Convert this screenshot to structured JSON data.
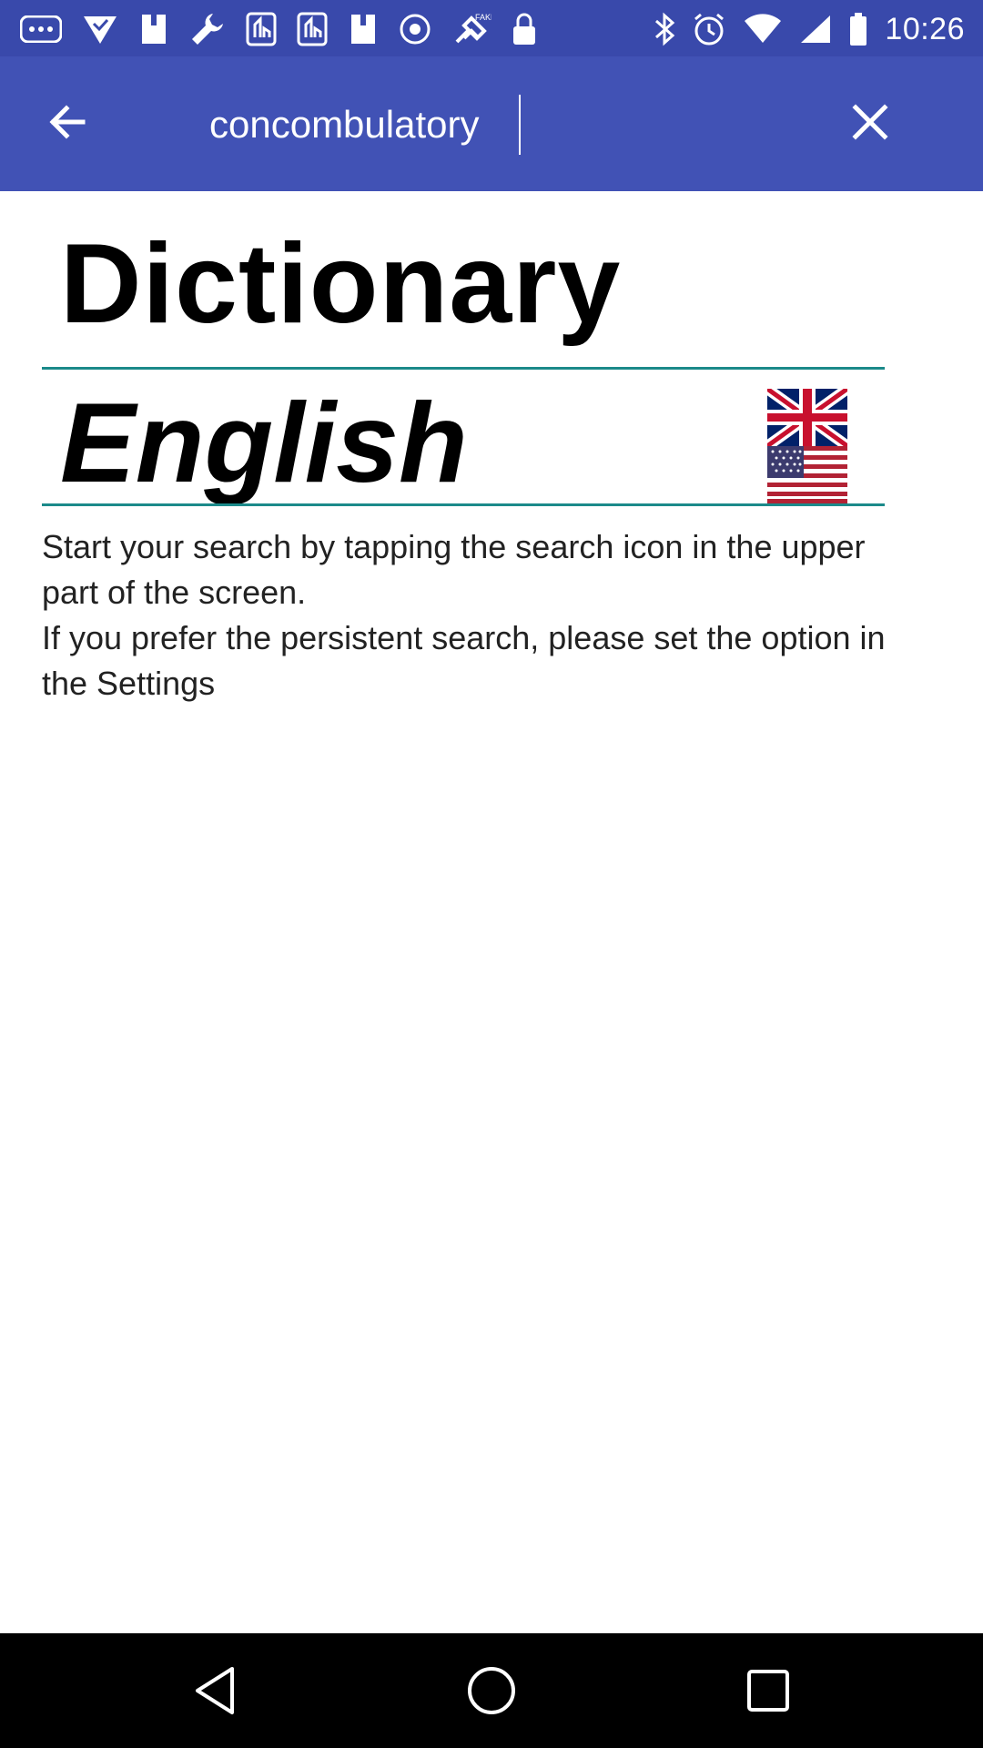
{
  "status_bar": {
    "time": "10:26",
    "left_icons": [
      "more-notifications-icon",
      "vpn-check-icon",
      "toolbox-icon",
      "wrench-icon",
      "signal-tool-icon",
      "signal-tool-icon",
      "toolbox-icon",
      "circle-dots-icon",
      "fake-gps-icon",
      "lock-icon"
    ],
    "right_icons": [
      "bluetooth-icon",
      "alarm-icon",
      "wifi-icon",
      "cell-signal-icon",
      "battery-icon"
    ]
  },
  "app_bar": {
    "search_value": "concombulatory",
    "back_icon": "arrow-back-icon",
    "clear_icon": "close-icon",
    "color": "#4152b5"
  },
  "main": {
    "title": "Dictionary",
    "language": "English",
    "flag_icon": "uk-us-flag-icon",
    "instructions": {
      "line1": "Start your search by tapping the search icon in the upper part of the screen.",
      "line2": "If you prefer the persistent search, please set the option in the Settings"
    },
    "divider_color": "#1b8a8a"
  },
  "nav_bar": {
    "back_icon": "nav-back-icon",
    "home_icon": "nav-home-icon",
    "recents_icon": "nav-recents-icon"
  }
}
